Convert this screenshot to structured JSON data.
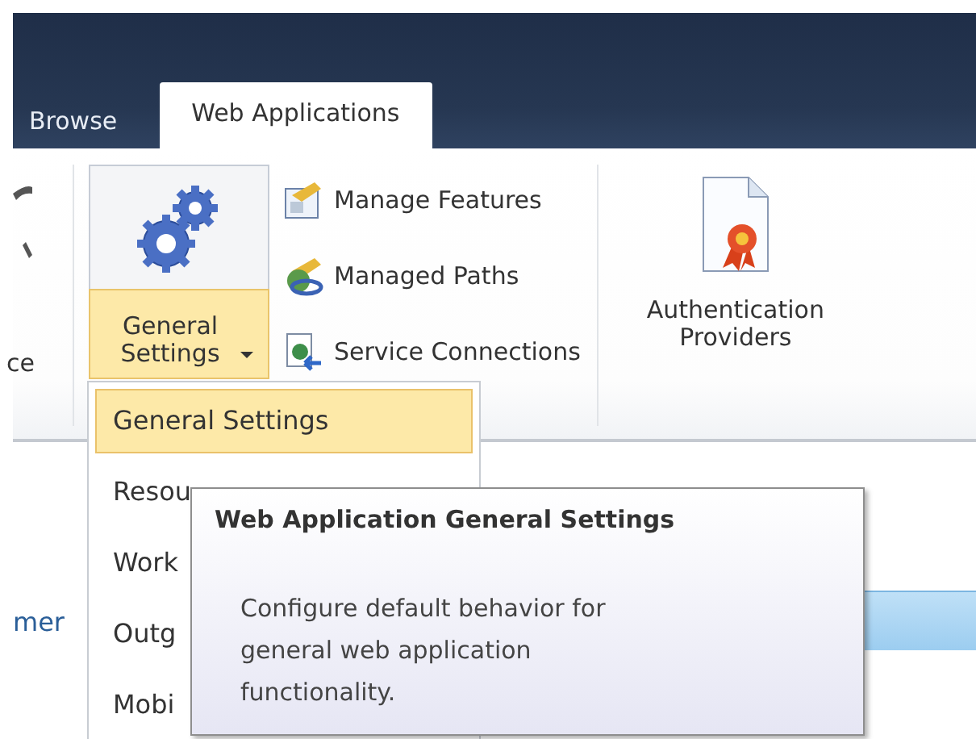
{
  "tabs": [
    {
      "label": "Browse",
      "selected": false
    },
    {
      "label": "Web Applications",
      "selected": true
    }
  ],
  "ribbon": {
    "cut_label": "ce",
    "split_button": {
      "label": "General Settings",
      "expanded": true
    },
    "commands": [
      {
        "label": "Manage Features"
      },
      {
        "label": "Managed Paths"
      },
      {
        "label": "Service Connections"
      }
    ],
    "large_button": {
      "label": "Authentication Providers"
    }
  },
  "content": {
    "link": "mer"
  },
  "menu": {
    "items": [
      {
        "label": "General Settings",
        "selected": true
      },
      {
        "label": "Resou",
        "selected": false
      },
      {
        "label": "Work",
        "selected": false
      },
      {
        "label": "Outg",
        "selected": false
      },
      {
        "label": "Mobi",
        "selected": false
      }
    ]
  },
  "tooltip": {
    "title": "Web Application General Settings",
    "description": "Configure default behavior for general web application functionality."
  }
}
